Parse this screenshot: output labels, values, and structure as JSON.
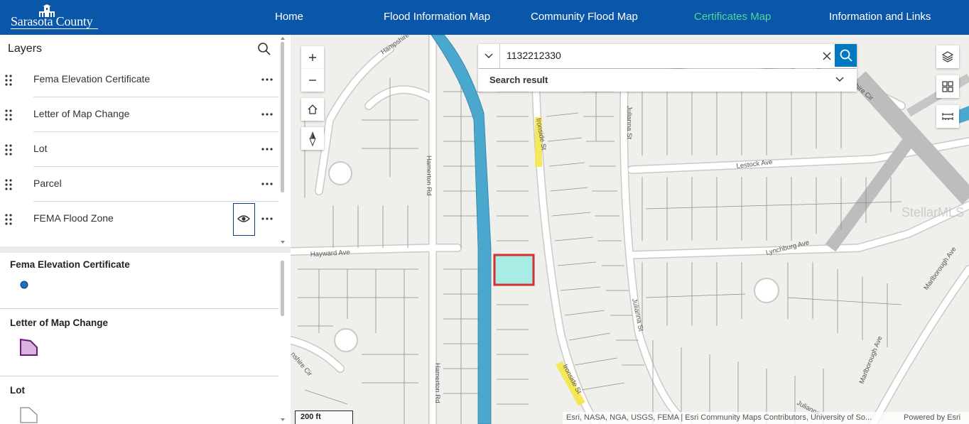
{
  "header": {
    "logo_text": "Sarasota County",
    "nav": [
      {
        "label": "Home",
        "active": false
      },
      {
        "label": "Flood Information Map",
        "active": false
      },
      {
        "label": "Community Flood Map",
        "active": false
      },
      {
        "label": "Certificates Map",
        "active": true
      },
      {
        "label": "Information and Links",
        "active": false
      }
    ],
    "active_color": "#4fd69a",
    "bar_color": "#0a56a8"
  },
  "layers_panel": {
    "title": "Layers",
    "search_icon": "search-icon",
    "layers": [
      {
        "name": "Fema Elevation Certificate"
      },
      {
        "name": "Letter of Map Change"
      },
      {
        "name": "Lot"
      },
      {
        "name": "Parcel"
      },
      {
        "name": "FEMA Flood Zone",
        "visibility_icon": "eye-icon"
      }
    ]
  },
  "legend": {
    "sections": [
      {
        "title": "Fema Elevation Certificate",
        "symbol": "blue-point",
        "color": "#1f6fc0"
      },
      {
        "title": "Letter of Map Change",
        "symbol": "purple-polygon",
        "color": "#d9b3e0"
      },
      {
        "title": "Lot",
        "symbol": "gray-polygon",
        "color": "#ffffff"
      }
    ]
  },
  "map": {
    "search": {
      "value": "1132212330",
      "result_label": "Search result"
    },
    "streets": {
      "hampshire": "Hampshire",
      "hamerton_1": "Hamerton Rd",
      "hamerton_2": "Hamerton Rd",
      "hayward": "Hayward Ave",
      "ironside_1": "Ironside St",
      "ironside_2": "Ironside St",
      "julianna_1": "Julianna St",
      "julianna_2": "Julianna St",
      "julianna_3": "Julianna",
      "lestock": "Lestock Ave",
      "lynchburg": "Lynchburg Ave",
      "marlborough_1": "Marlborough Ave",
      "marlborough_2": "Marlborough Ave",
      "shire_cir": "shire Cir",
      "nshire_cir": "nshire Cir"
    },
    "watermark": "StellarMLS",
    "scale_label": "200 ft",
    "attribution": "Esri, NASA, NGA, USGS, FEMA | Esri Community Maps Contributors, University of So...",
    "powered_by": "Powered by Esri",
    "canal_color": "#4aa8cf",
    "selected_parcel_fill": "#a8ece6",
    "selected_parcel_outline": "#d32f2f",
    "highlight_color": "#f5e64a"
  }
}
